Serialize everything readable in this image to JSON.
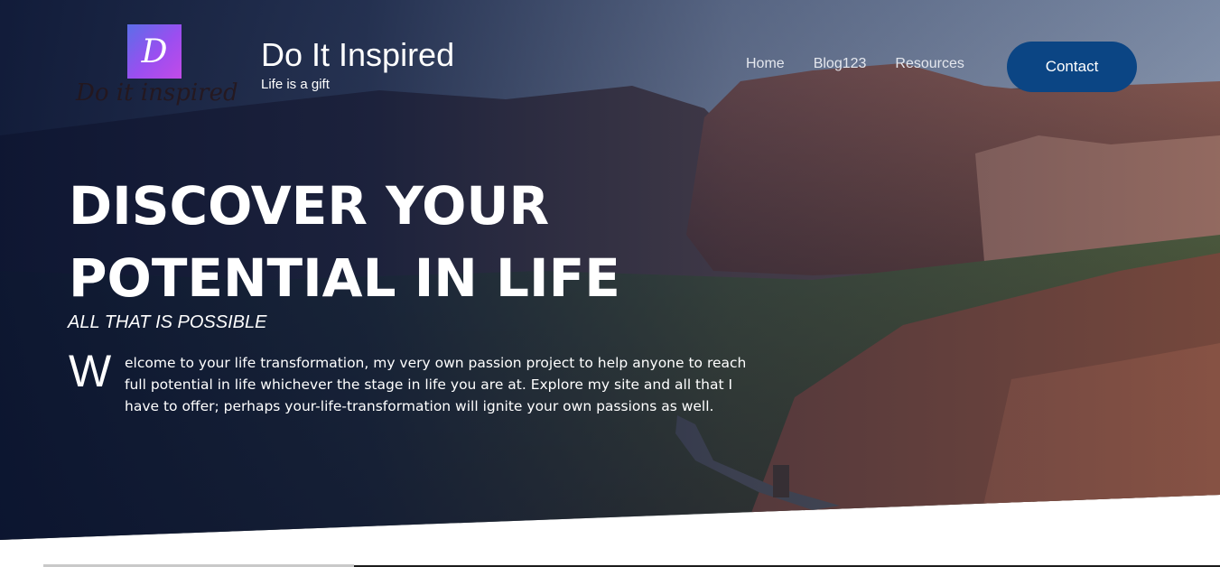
{
  "site": {
    "logo_letter": "D",
    "logo_script": "Do it inspired",
    "title": "Do It Inspired",
    "tagline": "Life is a gift"
  },
  "nav": {
    "items": [
      {
        "label": "Home"
      },
      {
        "label": "Blog123"
      },
      {
        "label": "Resources"
      }
    ],
    "contact_label": "Contact"
  },
  "hero": {
    "headline_line1": "DISCOVER YOUR",
    "headline_line2": "POTENTIAL IN LIFE",
    "subhead": "ALL THAT IS POSSIBLE",
    "dropcap": "W",
    "intro": "elcome to your life transformation, my very own passion project to help anyone to reach full potential in life whichever the stage in life you are at. Explore my site and all that I have to offer; perhaps your-life-transformation will ignite your own passions as well."
  },
  "colors": {
    "contact_button": "#0b4584",
    "overlay": "#081230",
    "logo_gradient_start": "#5b6ee8",
    "logo_gradient_end": "#c24be8"
  }
}
